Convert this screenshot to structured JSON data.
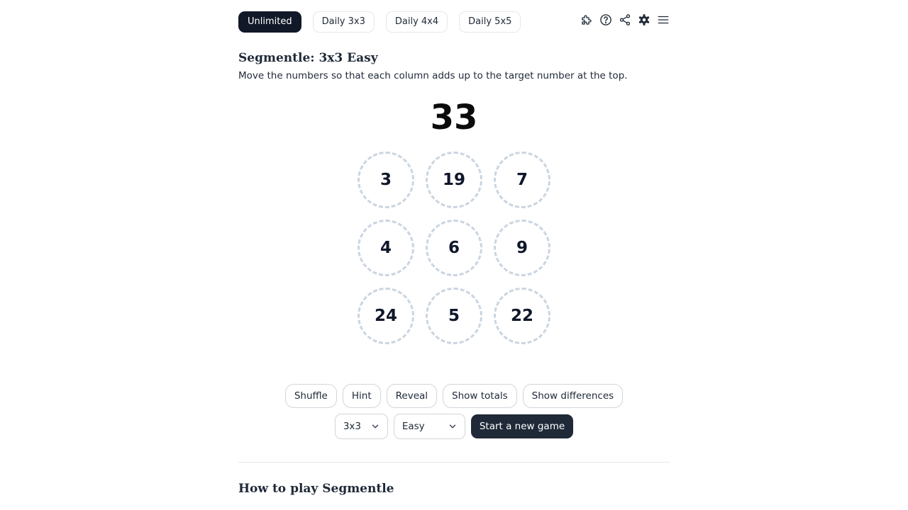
{
  "modes": {
    "unlimited": "Unlimited",
    "daily3": "Daily 3x3",
    "daily4": "Daily 4x4",
    "daily5": "Daily 5x5",
    "active": "Unlimited"
  },
  "toolbar_icons": [
    "puzzle-icon",
    "help-icon",
    "share-icon",
    "settings-icon",
    "menu-icon"
  ],
  "game": {
    "title": "Segmentle: 3x3 Easy",
    "instructions": "Move the numbers so that each column adds up to the target number at the top.",
    "target": "33",
    "grid": [
      [
        "3",
        "19",
        "7"
      ],
      [
        "4",
        "6",
        "9"
      ],
      [
        "24",
        "5",
        "22"
      ]
    ]
  },
  "actions": {
    "shuffle": "Shuffle",
    "hint": "Hint",
    "reveal": "Reveal",
    "show_totals": "Show totals",
    "show_differences": "Show differences"
  },
  "settings": {
    "size_value": "3x3",
    "difficulty_value": "Easy",
    "start_label": "Start a new game"
  },
  "howto": {
    "title": "How to play Segmentle"
  },
  "colors": {
    "primary_dark": "#111827",
    "button_dark": "#1f2937",
    "cell_border": "#cbd5e1",
    "divider": "#e5e7eb"
  }
}
